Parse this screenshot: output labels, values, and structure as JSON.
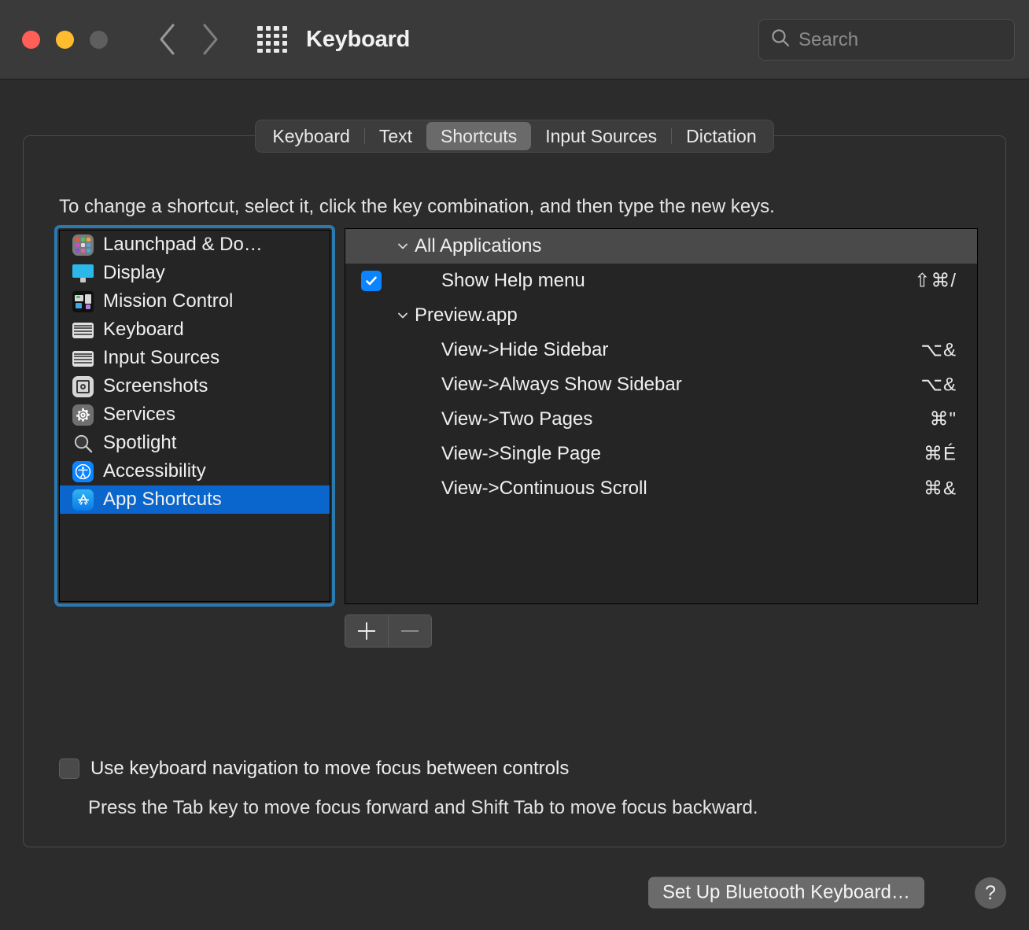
{
  "window": {
    "title": "Keyboard",
    "traffic_lights": [
      "close-button",
      "minimize-button",
      "zoom-button"
    ],
    "back_icon": "chevron-left-icon",
    "forward_icon": "chevron-right-icon",
    "grid_icon": "show-all-grid-icon"
  },
  "search": {
    "placeholder": "Search",
    "value": "",
    "icon": "search-icon"
  },
  "tabs": [
    {
      "label": "Keyboard",
      "selected": false
    },
    {
      "label": "Text",
      "selected": false
    },
    {
      "label": "Shortcuts",
      "selected": true
    },
    {
      "label": "Input Sources",
      "selected": false
    },
    {
      "label": "Dictation",
      "selected": false
    }
  ],
  "instructions": "To change a shortcut, select it, click the key combination, and then type the new keys.",
  "sidebar": {
    "focused": true,
    "items": [
      {
        "label": "Launchpad & Do…",
        "icon": "launchpad-icon",
        "selected": false
      },
      {
        "label": "Display",
        "icon": "display-icon",
        "selected": false
      },
      {
        "label": "Mission Control",
        "icon": "mission-control-icon",
        "selected": false
      },
      {
        "label": "Keyboard",
        "icon": "keyboard-icon",
        "selected": false
      },
      {
        "label": "Input Sources",
        "icon": "input-sources-icon",
        "selected": false
      },
      {
        "label": "Screenshots",
        "icon": "screenshots-icon",
        "selected": false
      },
      {
        "label": "Services",
        "icon": "services-gear-icon",
        "selected": false
      },
      {
        "label": "Spotlight",
        "icon": "spotlight-icon",
        "selected": false
      },
      {
        "label": "Accessibility",
        "icon": "accessibility-icon",
        "selected": false
      },
      {
        "label": "App Shortcuts",
        "icon": "app-store-icon",
        "selected": true
      }
    ]
  },
  "shortcut_list": {
    "rows": [
      {
        "type": "group",
        "label": "All Applications",
        "expanded": true,
        "keys": ""
      },
      {
        "type": "item",
        "label": "Show Help menu",
        "checked": true,
        "keys": "⇧⌘/"
      },
      {
        "type": "group",
        "label": "Preview.app",
        "expanded": true,
        "keys": ""
      },
      {
        "type": "item",
        "label": "View->Hide Sidebar",
        "checked": false,
        "keys": "⌥&"
      },
      {
        "type": "item",
        "label": "View->Always Show Sidebar",
        "checked": false,
        "keys": "⌥&"
      },
      {
        "type": "item",
        "label": "View->Two Pages",
        "checked": false,
        "keys": "⌘\""
      },
      {
        "type": "item",
        "label": "View->Single Page",
        "checked": false,
        "keys": "⌘É"
      },
      {
        "type": "item",
        "label": "View->Continuous Scroll",
        "checked": false,
        "keys": "⌘&"
      }
    ]
  },
  "list_controls": {
    "add_label": "+",
    "remove_label": "−",
    "add_enabled": true,
    "remove_enabled": false
  },
  "keyboard_navigation": {
    "label": "Use keyboard navigation to move focus between controls",
    "checked": false,
    "hint": "Press the Tab key to move focus forward and Shift Tab to move focus backward."
  },
  "footer": {
    "bluetooth_button": "Set Up Bluetooth Keyboard…",
    "help_button": "?"
  },
  "colors": {
    "selection_blue": "#0a66cc",
    "focus_ring": "#2a7ab0",
    "checkbox_blue": "#0a84ff",
    "window_bg": "#2c2c2c",
    "titlebar_bg": "#3a3a3a",
    "list_bg": "#252525",
    "group_header_bg": "#4a4a4a"
  }
}
